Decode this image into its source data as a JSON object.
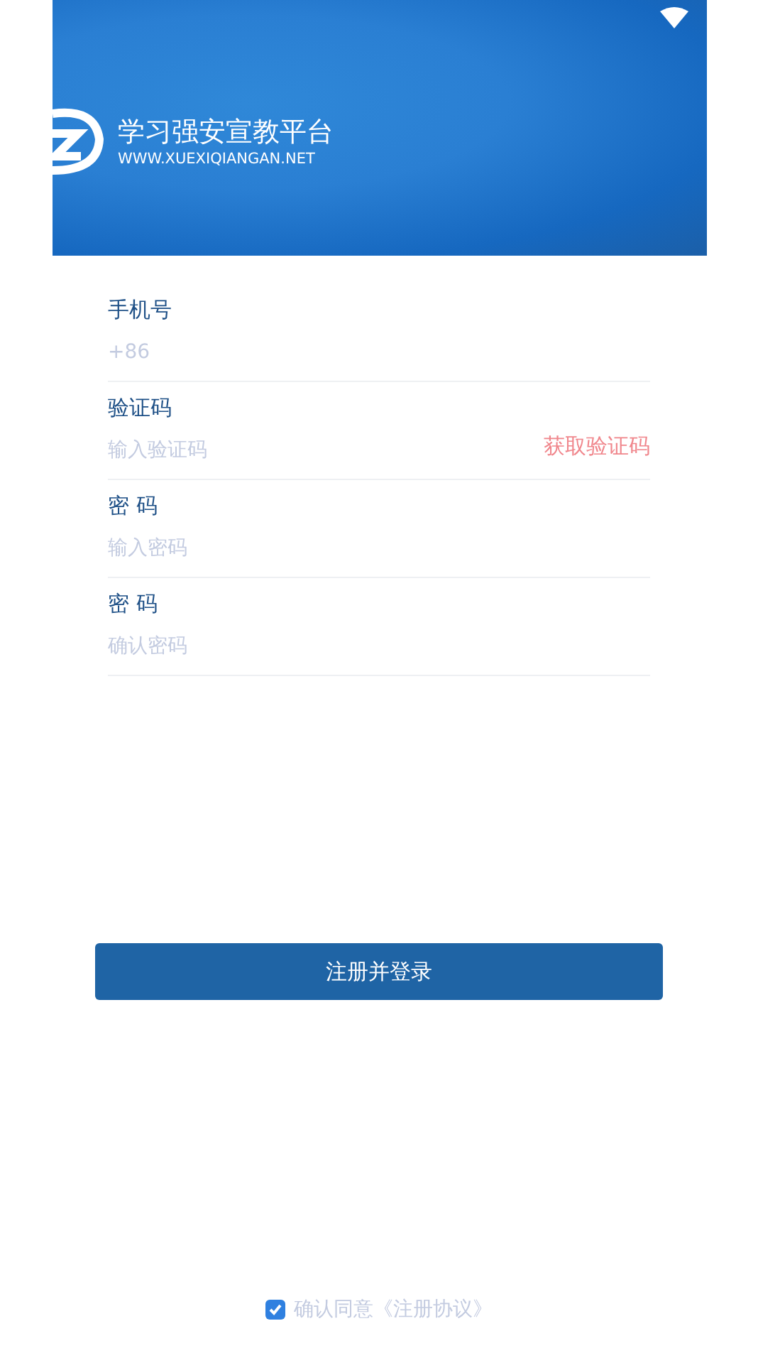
{
  "header": {
    "title": "学习强安宣教平台",
    "url": "WWW.XUEXIQIANGAN.NET"
  },
  "fields": [
    {
      "label": "手机号",
      "placeholder": "+86"
    },
    {
      "label": "验证码",
      "placeholder": "输入验证码",
      "action": "获取验证码"
    },
    {
      "label": "密 码",
      "placeholder": "输入密码"
    },
    {
      "label": "密 码",
      "placeholder": "确认密码"
    }
  ],
  "submit": "注册并登录",
  "agreement": {
    "checked": true,
    "text": "确认同意《注册协议》"
  }
}
